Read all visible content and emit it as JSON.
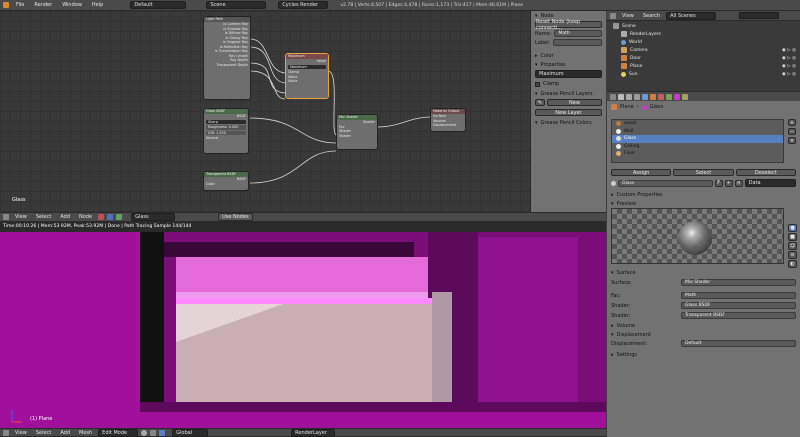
{
  "topbar": {
    "menus": [
      "File",
      "Render",
      "Window",
      "Help"
    ],
    "layout": "Default",
    "scene": "Scene",
    "engine": "Cycles Render",
    "stats": "v2.78 | Verts:4,507 | Edges:4,478 | Faces:1,173 | Tris:417 | Mem:46.61M | Plane"
  },
  "node_editor": {
    "frame_label": "Glass",
    "header": {
      "menus": [
        "View",
        "Select",
        "Add",
        "Node"
      ],
      "material": "Glass",
      "use_nodes": "Use Nodes"
    },
    "nodes": {
      "light_path": {
        "title": "Light Path",
        "outputs": [
          "Is Camera Ray",
          "Is Shadow Ray",
          "Is Diffuse Ray",
          "Is Glossy Ray",
          "Is Singular Ray",
          "Is Reflection Ray",
          "Is Transmission Ray",
          "Ray Length",
          "Ray Depth",
          "Transparent Depth"
        ]
      },
      "math": {
        "title": "Maximum",
        "output": "Value",
        "operation": "Maximum",
        "clamp": "Clamp",
        "inputs": [
          "Value",
          "Value"
        ]
      },
      "glass": {
        "title": "Glass BSDF",
        "output": "BSDF",
        "distribution": "Sharp",
        "roughness": "Roughness: 0.000",
        "ior": "IOR: 1.450",
        "normal": "Normal"
      },
      "transparent": {
        "title": "Transparent BSDF",
        "output": "BSDF",
        "color": "Color"
      },
      "mix": {
        "title": "Mix Shader",
        "output": "Shader",
        "inputs": [
          "Fac",
          "Shader",
          "Shader"
        ]
      },
      "output": {
        "title": "Material Output",
        "inputs": [
          "Surface",
          "Volume",
          "Displacement"
        ]
      }
    }
  },
  "node_sidebar": {
    "node_header": "Node",
    "reset_button": "Reset Node (keep connecti...",
    "name_label": "Name:",
    "name_value": "Math",
    "label_label": "Label:",
    "color_header": "Color",
    "properties_header": "Properties",
    "operation": "Maximum",
    "clamp": "Clamp",
    "gp_layers_header": "Grease Pencil Layers",
    "new_button": "New",
    "new_layer_button": "New Layer",
    "gp_colors_header": "Grease Pencil Colors"
  },
  "render": {
    "status": "Time:00:10.26 | Mem:53.92M, Peak:53.92M | Done | Path Tracing Sample 144/144",
    "object_label": "(1) Plane"
  },
  "viewport_header": {
    "menus": [
      "View",
      "Select",
      "Add",
      "Mesh"
    ],
    "mode": "Edit Mode",
    "orientation": "Global",
    "layer": "RenderLayer"
  },
  "outliner": {
    "header": {
      "view": "View",
      "search": "Search",
      "filter": "All Scenes"
    },
    "items": [
      "Scene",
      "RenderLayers",
      "World",
      "Camera",
      "Door",
      "Plane",
      "Sun"
    ]
  },
  "properties": {
    "breadcrumb": [
      "Plane",
      "Glass"
    ],
    "materials": [
      "wood",
      "Wall",
      "Glass",
      "Ceiling",
      "Floor"
    ],
    "selected_material": "Glass",
    "assign": "Assign",
    "select": "Select",
    "deselect": "Deselect",
    "material_name": "Glass",
    "link": "Data",
    "custom_props": "Custom Properties",
    "preview": "Preview",
    "surface_header": "Surface",
    "surface_label": "Surface:",
    "surface_value": "Mix Shader",
    "fac_label": "Fac:",
    "fac_value": "Math",
    "shader1_label": "Shader:",
    "shader1_value": "Glass BSDF",
    "shader2_label": "Shader:",
    "shader2_value": "Transparent BSDF",
    "volume_header": "Volume",
    "displacement_header": "Displacement",
    "displacement_label": "Displacement:",
    "displacement_value": "Default",
    "settings_header": "Settings"
  },
  "colors": {
    "selected": "#5680c2",
    "render_magenta": "#a0109a",
    "panel": "#727272"
  }
}
